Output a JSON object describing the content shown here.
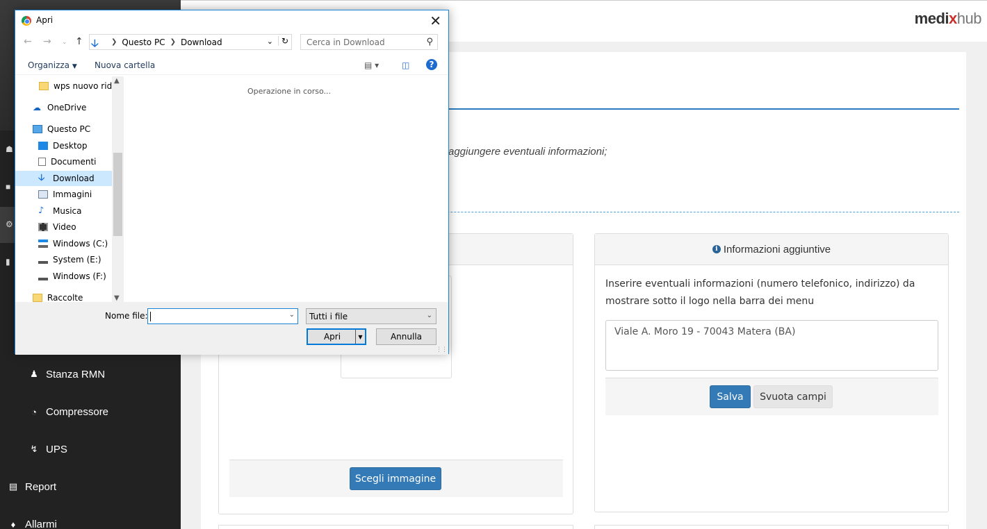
{
  "brand": {
    "part1": "medi",
    "part2": "x",
    "part3": "hub"
  },
  "sidebar": {
    "items": [
      {
        "label": "Stanza RMN",
        "icon": "user-md-icon"
      },
      {
        "label": "Compressore",
        "icon": "dashboard-icon"
      },
      {
        "label": "UPS",
        "icon": "bolt-icon"
      },
      {
        "label": "Report",
        "icon": "inbox-icon"
      },
      {
        "label": "Allarmi",
        "icon": "bell-icon"
      }
    ]
  },
  "main": {
    "intro_text": "aggiungere eventuali informazioni;",
    "right_panel": {
      "title": "Informazioni aggiuntive",
      "description": "Inserire eventuali informazioni (numero telefonico, indirizzo) da mostrare sotto il logo nella barra dei menu",
      "textarea_value": "Viale A. Moro 19 - 70043 Matera (BA)",
      "save_label": "Salva",
      "clear_label": "Svuota campi"
    },
    "left_panel": {
      "choose_label": "Scegli immagine"
    }
  },
  "dialog": {
    "title": "Apri",
    "address": {
      "root": "Questo PC",
      "folder": "Download"
    },
    "search_placeholder": "Cerca in Download",
    "toolbar": {
      "organize": "Organizza",
      "new_folder": "Nuova cartella"
    },
    "tree": [
      {
        "label": "wps nuovo ridim",
        "icon": "folder-icon"
      },
      {
        "label": "OneDrive",
        "icon": "onedrive-icon"
      },
      {
        "label": "Questo PC",
        "icon": "computer-icon"
      },
      {
        "label": "Desktop",
        "icon": "desktop-icon"
      },
      {
        "label": "Documenti",
        "icon": "document-icon"
      },
      {
        "label": "Download",
        "icon": "download-icon"
      },
      {
        "label": "Immagini",
        "icon": "pictures-icon"
      },
      {
        "label": "Musica",
        "icon": "music-icon"
      },
      {
        "label": "Video",
        "icon": "video-icon"
      },
      {
        "label": "Windows (C:)",
        "icon": "drive-icon"
      },
      {
        "label": "System (E:)",
        "icon": "drive-icon"
      },
      {
        "label": "Windows (F:)",
        "icon": "drive-icon"
      },
      {
        "label": "Raccolte",
        "icon": "libraries-icon"
      }
    ],
    "selected_tree_item": "Download",
    "loading_text": "Operazione in corso...",
    "file_name_label": "Nome file:",
    "file_name_value": "",
    "file_type": "Tutti i file",
    "open_label": "Apri",
    "cancel_label": "Annulla"
  }
}
